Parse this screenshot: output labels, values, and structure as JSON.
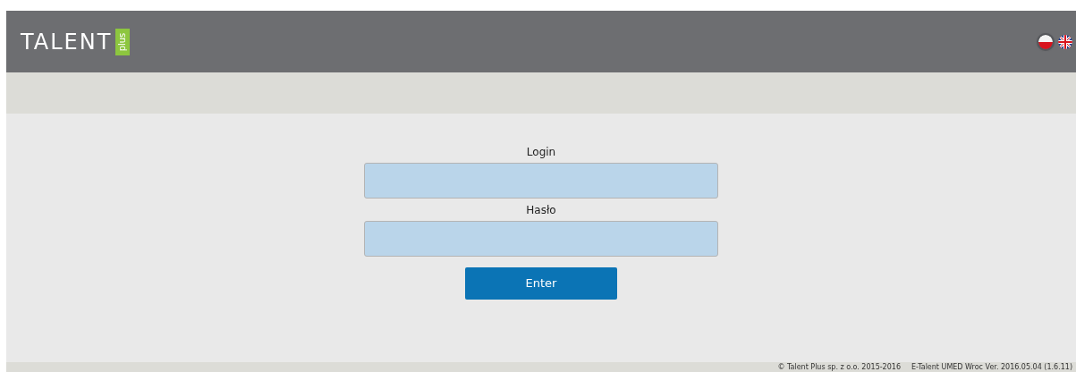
{
  "header": {
    "logo_text": "TALENT",
    "logo_badge": "plus",
    "languages": [
      {
        "kind": "pl",
        "selected": true
      },
      {
        "kind": "en",
        "selected": false
      }
    ]
  },
  "form": {
    "fields": [
      {
        "label": "Login"
      },
      {
        "label": "Hasło"
      }
    ],
    "submit": "Enter"
  },
  "footer": {
    "copyright": "© Talent Plus sp. z o.o. 2015-2016",
    "version": "E-Talent UMED Wroc Ver. 2016.05.04 (1.6.11)"
  }
}
